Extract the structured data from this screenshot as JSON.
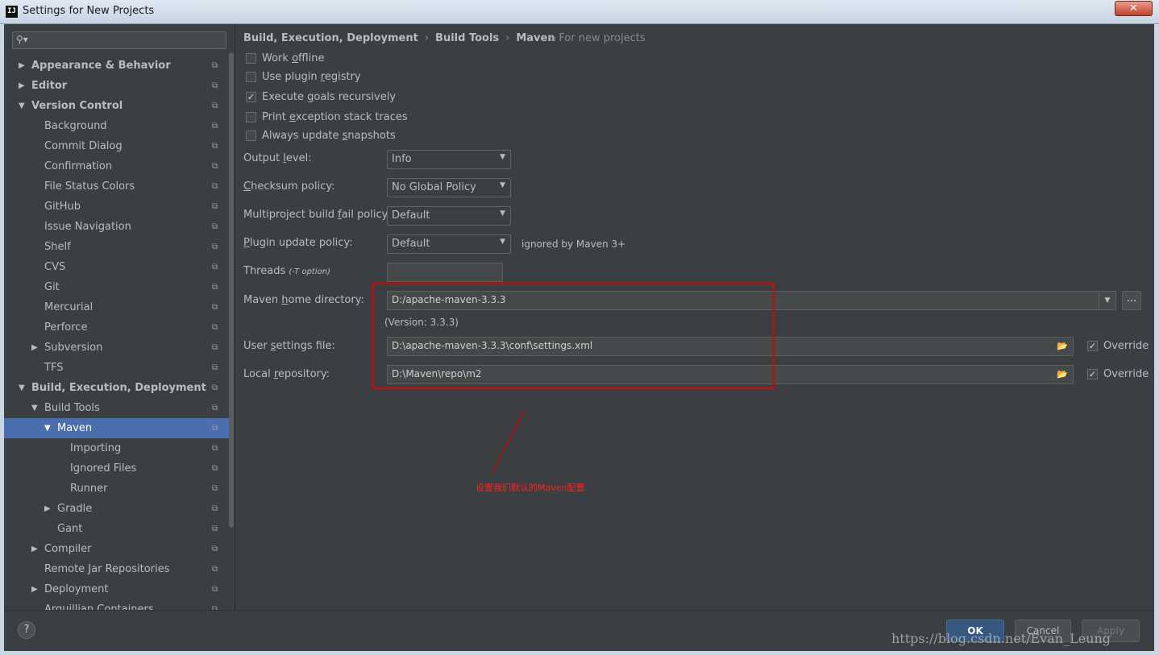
{
  "window": {
    "title": "Settings for New Projects",
    "close_label": "✕",
    "app_icon_label": "IJ"
  },
  "sidebar": {
    "search_placeholder": "",
    "items": [
      {
        "label": "Appearance & Behavior",
        "level": 0,
        "arrow": "▶",
        "bold": true
      },
      {
        "label": "Editor",
        "level": 0,
        "arrow": "▶",
        "bold": true
      },
      {
        "label": "Version Control",
        "level": 0,
        "arrow": "▼",
        "bold": true
      },
      {
        "label": "Background",
        "level": 1,
        "arrow": ""
      },
      {
        "label": "Commit Dialog",
        "level": 1,
        "arrow": ""
      },
      {
        "label": "Confirmation",
        "level": 1,
        "arrow": ""
      },
      {
        "label": "File Status Colors",
        "level": 1,
        "arrow": ""
      },
      {
        "label": "GitHub",
        "level": 1,
        "arrow": ""
      },
      {
        "label": "Issue Navigation",
        "level": 1,
        "arrow": ""
      },
      {
        "label": "Shelf",
        "level": 1,
        "arrow": ""
      },
      {
        "label": "CVS",
        "level": 1,
        "arrow": ""
      },
      {
        "label": "Git",
        "level": 1,
        "arrow": ""
      },
      {
        "label": "Mercurial",
        "level": 1,
        "arrow": ""
      },
      {
        "label": "Perforce",
        "level": 1,
        "arrow": ""
      },
      {
        "label": "Subversion",
        "level": 1,
        "arrow": "▶"
      },
      {
        "label": "TFS",
        "level": 1,
        "arrow": ""
      },
      {
        "label": "Build, Execution, Deployment",
        "level": 0,
        "arrow": "▼",
        "bold": true
      },
      {
        "label": "Build Tools",
        "level": 1,
        "arrow": "▼"
      },
      {
        "label": "Maven",
        "level": 2,
        "arrow": "▼",
        "selected": true
      },
      {
        "label": "Importing",
        "level": 3,
        "arrow": ""
      },
      {
        "label": "Ignored Files",
        "level": 3,
        "arrow": ""
      },
      {
        "label": "Runner",
        "level": 3,
        "arrow": ""
      },
      {
        "label": "Gradle",
        "level": 2,
        "arrow": "▶"
      },
      {
        "label": "Gant",
        "level": 2,
        "arrow": ""
      },
      {
        "label": "Compiler",
        "level": 1,
        "arrow": "▶"
      },
      {
        "label": "Remote Jar Repositories",
        "level": 1,
        "arrow": ""
      },
      {
        "label": "Deployment",
        "level": 1,
        "arrow": "▶"
      },
      {
        "label": "Arquillian Containers",
        "level": 1,
        "arrow": ""
      }
    ]
  },
  "breadcrumb": [
    "Build, Execution, Deployment",
    "Build Tools",
    "Maven"
  ],
  "for_new_projects": "For new projects",
  "checkboxes": [
    {
      "pre": "Work ",
      "mn": "o",
      "post": "ffline",
      "checked": false
    },
    {
      "pre": "Use plugin ",
      "mn": "r",
      "post": "egistry",
      "checked": false
    },
    {
      "pre": "Execute ",
      "mn": "g",
      "post": "oals recursively",
      "checked": true
    },
    {
      "pre": "Print ",
      "mn": "e",
      "post": "xception stack traces",
      "checked": false
    },
    {
      "pre": "Always update ",
      "mn": "s",
      "post": "napshots",
      "checked": false
    }
  ],
  "form": {
    "output_level": {
      "pre": "Output ",
      "mn": "l",
      "post": "evel:",
      "value": "Info"
    },
    "checksum_policy": {
      "pre": "",
      "mn": "C",
      "post": "hecksum policy:",
      "value": "No Global Policy"
    },
    "fail_policy": {
      "pre": "Multiproject build ",
      "mn": "f",
      "post": "ail policy:",
      "value": "Default"
    },
    "plugin_update": {
      "pre": "",
      "mn": "P",
      "post": "lugin update policy:",
      "value": "Default",
      "hint": "ignored by Maven 3+"
    },
    "threads": {
      "label": "Threads",
      "option": "(-T option)",
      "value": ""
    },
    "maven_home": {
      "pre": "Maven ",
      "mn": "h",
      "post": "ome directory:",
      "value": "D:/apache-maven-3.3.3",
      "version": "(Version: 3.3.3)",
      "browse": "..."
    },
    "user_settings": {
      "pre": "User ",
      "mn": "s",
      "post": "ettings file:",
      "value": "D:\\apache-maven-3.3.3\\conf\\settings.xml",
      "override": "Override",
      "checked": true
    },
    "local_repo": {
      "pre": "Local ",
      "mn": "r",
      "post": "epository:",
      "value": "D:\\Maven\\repo\\m2",
      "override": "Override",
      "checked": true
    }
  },
  "annotation": {
    "text": "设置我们默认的Maven配置",
    "color": "#ff2020"
  },
  "buttons": {
    "help": "?",
    "ok": "OK",
    "cancel": "Cancel",
    "apply": "Apply"
  },
  "watermark": "https://blog.csdn.net/Evan_Leung",
  "colors": {
    "background": "#3c3f41",
    "selection": "#4b6eaf",
    "ok_button": "#365880",
    "highlight_border": "#e00000"
  }
}
